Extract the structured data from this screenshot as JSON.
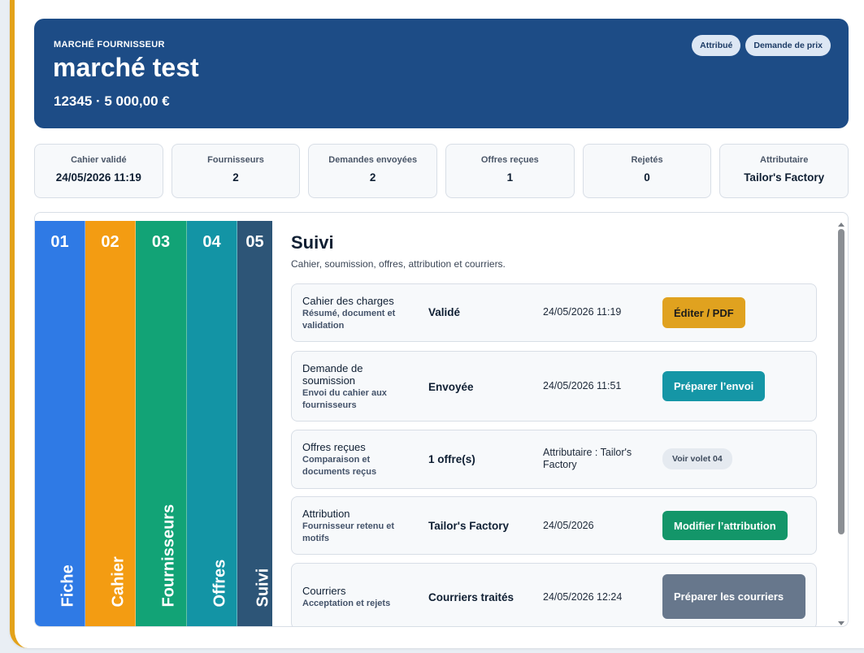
{
  "header": {
    "eyebrow": "MARCHÉ FOURNISSEUR",
    "title": "marché test",
    "subtitle": "12345 · 5 000,00 €",
    "badges": [
      "Attribué",
      "Demande de prix"
    ]
  },
  "stats": [
    {
      "label": "Cahier validé",
      "value": "24/05/2026 11:19"
    },
    {
      "label": "Fournisseurs",
      "value": "2"
    },
    {
      "label": "Demandes envoyées",
      "value": "2"
    },
    {
      "label": "Offres reçues",
      "value": "1"
    },
    {
      "label": "Rejetés",
      "value": "0"
    },
    {
      "label": "Attributaire",
      "value": "Tailor's Factory"
    }
  ],
  "tabs": [
    {
      "num": "01",
      "label": "Fiche"
    },
    {
      "num": "02",
      "label": "Cahier"
    },
    {
      "num": "03",
      "label": "Fournisseurs"
    },
    {
      "num": "04",
      "label": "Offres"
    },
    {
      "num": "05",
      "label": "Suivi"
    }
  ],
  "content": {
    "title": "Suivi",
    "description": "Cahier, soumission, offres, attribution et courriers.",
    "rows": [
      {
        "title": "Cahier des charges",
        "subtitle": "Résumé, document et validation",
        "status": "Validé",
        "info": "24/05/2026 11:19",
        "action": "Éditer / PDF"
      },
      {
        "title": "Demande de soumission",
        "subtitle": "Envoi du cahier aux fournisseurs",
        "status": "Envoyée",
        "info": "24/05/2026 11:51",
        "action": "Préparer l’envoi"
      },
      {
        "title": "Offres reçues",
        "subtitle": "Comparaison et documents reçus",
        "status": "1 offre(s)",
        "info": "Attributaire : Tailor's Factory",
        "action": "Voir volet 04"
      },
      {
        "title": "Attribution",
        "subtitle": "Fournisseur retenu et motifs",
        "status": "Tailor's Factory",
        "info": "24/05/2026",
        "action": "Modifier l’attribution"
      },
      {
        "title": "Courriers",
        "subtitle": "Acceptation et rejets",
        "status": "Courriers traités",
        "info": "24/05/2026 12:24",
        "action": "Préparer les courriers"
      }
    ]
  },
  "colors": {
    "banner": "#1d4c86",
    "accent_border": "#e3a21a",
    "tab_fiche": "#2f7ae5",
    "tab_cahier": "#f39c12",
    "tab_fournisseurs": "#12a376",
    "tab_offres": "#1394a5",
    "tab_suivi": "#2d5577",
    "btn_edit": "#e0a21f",
    "btn_envoi": "#1596a6",
    "btn_attribution": "#139669",
    "btn_courriers": "#67778c"
  }
}
